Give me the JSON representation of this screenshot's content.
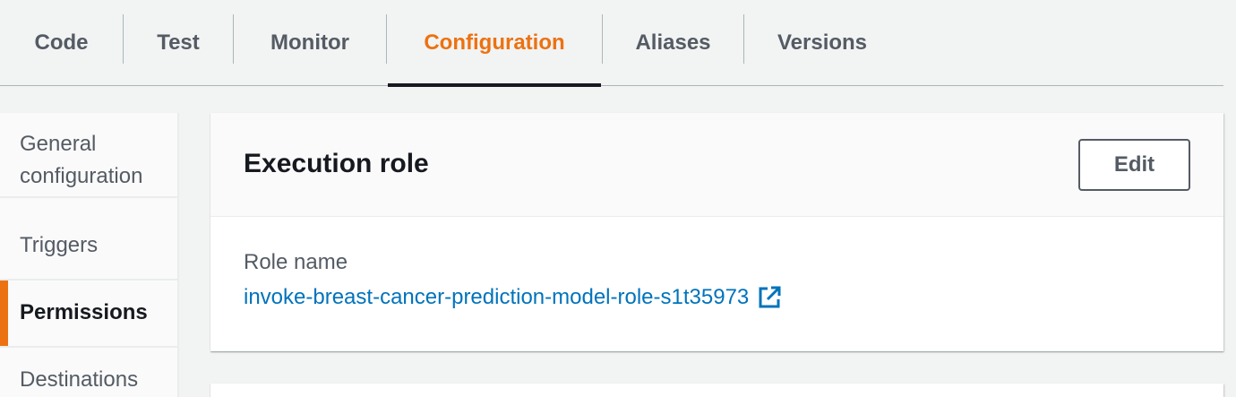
{
  "tabs": [
    {
      "label": "Code",
      "active": false
    },
    {
      "label": "Test",
      "active": false
    },
    {
      "label": "Monitor",
      "active": false
    },
    {
      "label": "Configuration",
      "active": true
    },
    {
      "label": "Aliases",
      "active": false
    },
    {
      "label": "Versions",
      "active": false
    }
  ],
  "sidenav": {
    "items": [
      {
        "label": "General configuration",
        "active": false
      },
      {
        "label": "Triggers",
        "active": false
      },
      {
        "label": "Permissions",
        "active": true
      },
      {
        "label": "Destinations",
        "active": false
      }
    ]
  },
  "execution_role": {
    "title": "Execution role",
    "edit_label": "Edit",
    "role_name_label": "Role name",
    "role_name_value": "invoke-breast-cancer-prediction-model-role-s1t35973",
    "external_link_icon": "external-link-icon"
  },
  "colors": {
    "accent": "#ec7211",
    "link": "#0073bb",
    "text": "#16191f",
    "muted": "#545b64",
    "background": "#f2f3f3"
  }
}
